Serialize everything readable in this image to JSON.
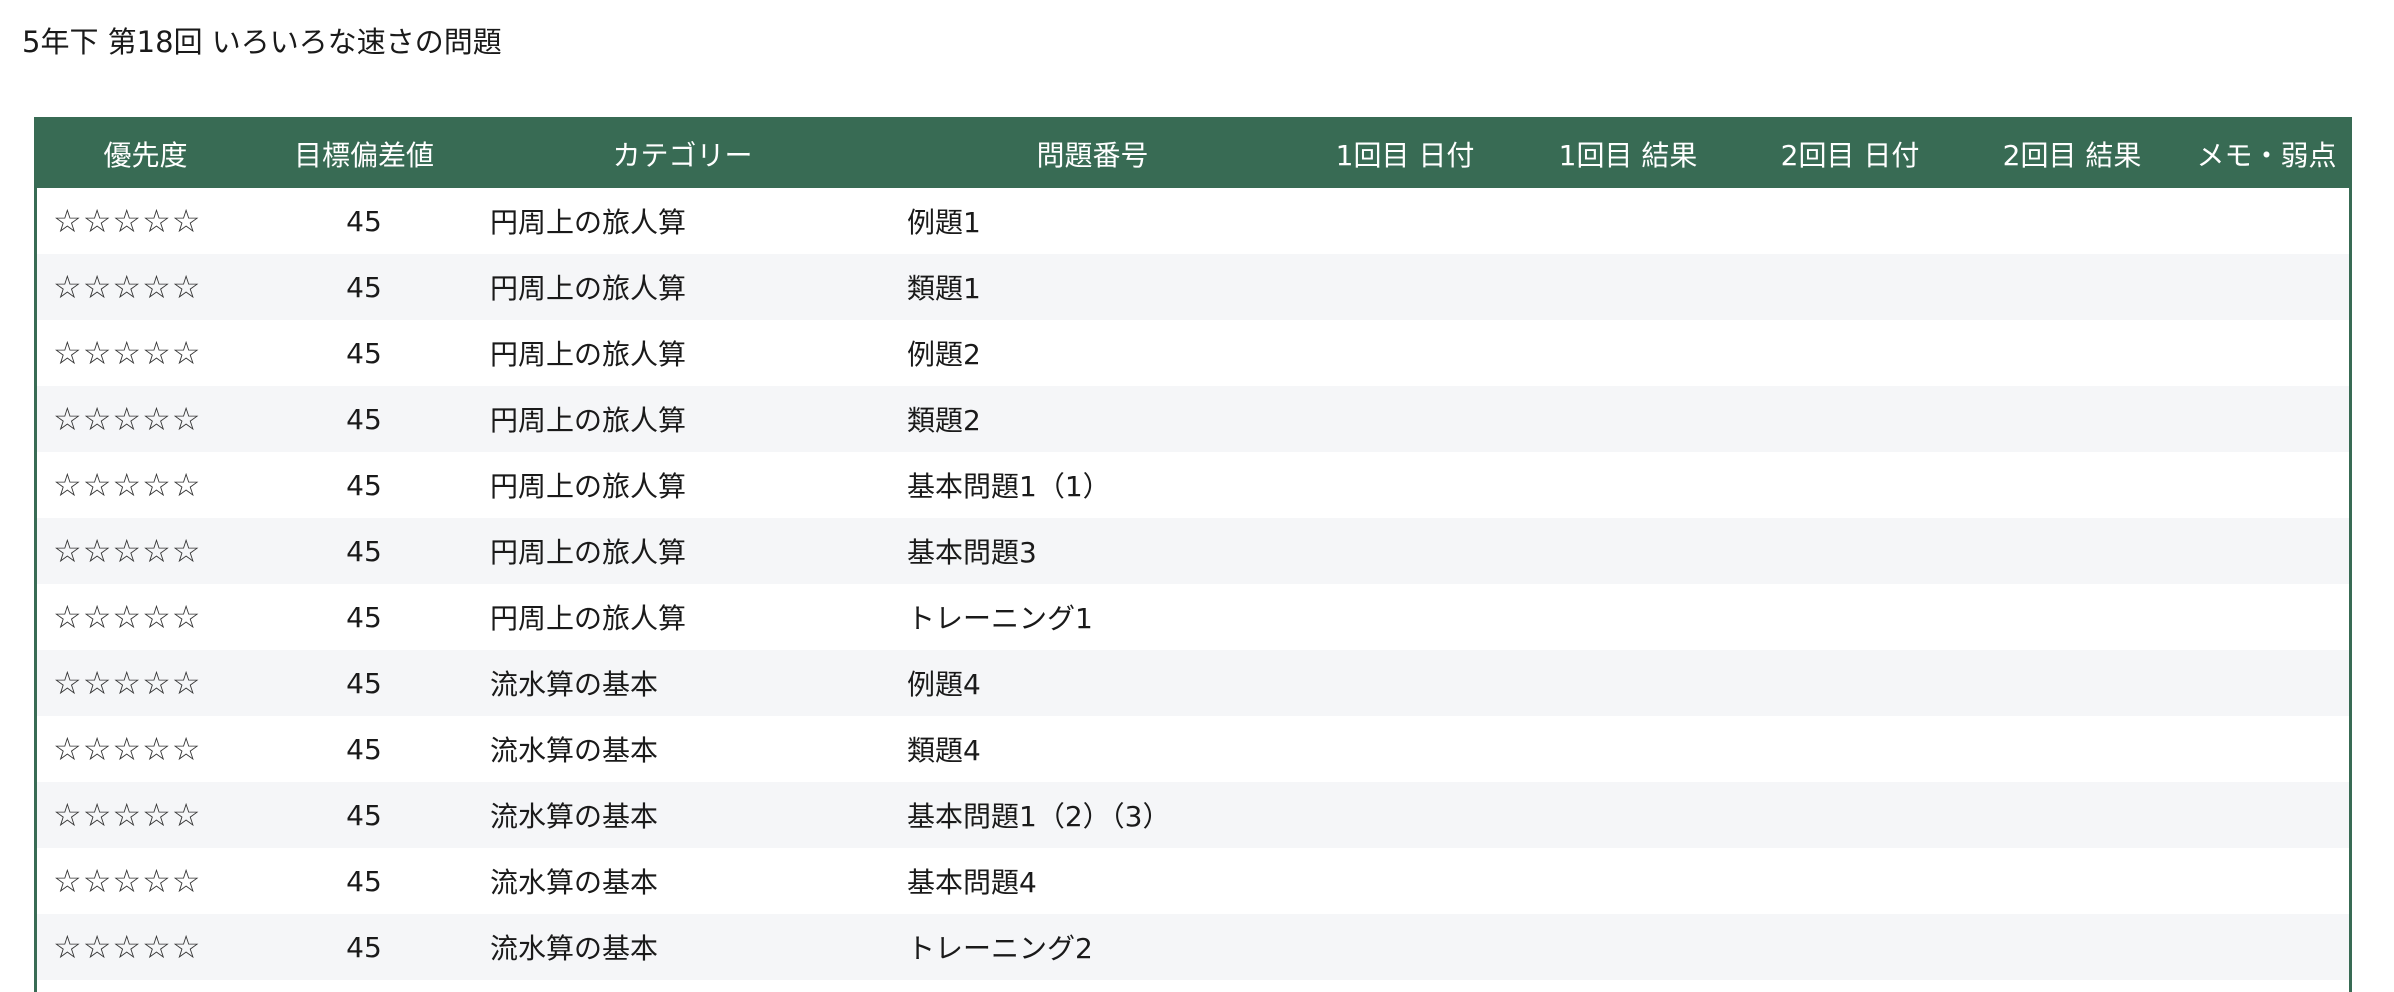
{
  "page": {
    "title": "5年下 第18回 いろいろな速さの問題"
  },
  "table": {
    "columns": [
      "優先度",
      "目標偏差値",
      "カテゴリー",
      "問題番号",
      "1回目 日付",
      "1回目 結果",
      "2回目 日付",
      "2回目 結果",
      "メモ・弱点"
    ],
    "rows": [
      {
        "priority": "☆☆☆☆☆",
        "deviation": "45",
        "category": "円周上の旅人算",
        "problem": "例題1",
        "date1": "",
        "result1": "",
        "date2": "",
        "result2": "",
        "memo": ""
      },
      {
        "priority": "☆☆☆☆☆",
        "deviation": "45",
        "category": "円周上の旅人算",
        "problem": "類題1",
        "date1": "",
        "result1": "",
        "date2": "",
        "result2": "",
        "memo": ""
      },
      {
        "priority": "☆☆☆☆☆",
        "deviation": "45",
        "category": "円周上の旅人算",
        "problem": "例題2",
        "date1": "",
        "result1": "",
        "date2": "",
        "result2": "",
        "memo": ""
      },
      {
        "priority": "☆☆☆☆☆",
        "deviation": "45",
        "category": "円周上の旅人算",
        "problem": "類題2",
        "date1": "",
        "result1": "",
        "date2": "",
        "result2": "",
        "memo": ""
      },
      {
        "priority": "☆☆☆☆☆",
        "deviation": "45",
        "category": "円周上の旅人算",
        "problem": "基本問題1（1）",
        "date1": "",
        "result1": "",
        "date2": "",
        "result2": "",
        "memo": ""
      },
      {
        "priority": "☆☆☆☆☆",
        "deviation": "45",
        "category": "円周上の旅人算",
        "problem": "基本問題3",
        "date1": "",
        "result1": "",
        "date2": "",
        "result2": "",
        "memo": ""
      },
      {
        "priority": "☆☆☆☆☆",
        "deviation": "45",
        "category": "円周上の旅人算",
        "problem": "トレーニング1",
        "date1": "",
        "result1": "",
        "date2": "",
        "result2": "",
        "memo": ""
      },
      {
        "priority": "☆☆☆☆☆",
        "deviation": "45",
        "category": "流水算の基本",
        "problem": "例題4",
        "date1": "",
        "result1": "",
        "date2": "",
        "result2": "",
        "memo": ""
      },
      {
        "priority": "☆☆☆☆☆",
        "deviation": "45",
        "category": "流水算の基本",
        "problem": "類題4",
        "date1": "",
        "result1": "",
        "date2": "",
        "result2": "",
        "memo": ""
      },
      {
        "priority": "☆☆☆☆☆",
        "deviation": "45",
        "category": "流水算の基本",
        "problem": "基本問題1（2）（3）",
        "date1": "",
        "result1": "",
        "date2": "",
        "result2": "",
        "memo": ""
      },
      {
        "priority": "☆☆☆☆☆",
        "deviation": "45",
        "category": "流水算の基本",
        "problem": "基本問題4",
        "date1": "",
        "result1": "",
        "date2": "",
        "result2": "",
        "memo": ""
      },
      {
        "priority": "☆☆☆☆☆",
        "deviation": "45",
        "category": "流水算の基本",
        "problem": "トレーニング2",
        "date1": "",
        "result1": "",
        "date2": "",
        "result2": "",
        "memo": ""
      }
    ]
  },
  "colors": {
    "header_bg": "#386b54",
    "header_text": "#ffffff",
    "row_alt_bg": "#f5f6f8"
  }
}
